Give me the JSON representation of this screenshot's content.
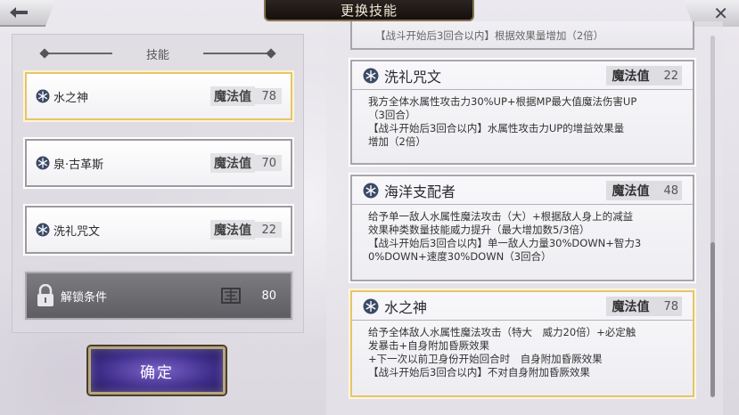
{
  "header": {
    "title": "更换技能"
  },
  "left_panel": {
    "title": "技能",
    "skills": [
      {
        "name": "水之神",
        "mp_label": "魔法值",
        "mp": "78",
        "selected": true
      },
      {
        "name": "泉·古革斯",
        "mp_label": "魔法值",
        "mp": "70",
        "selected": false
      },
      {
        "name": "洗礼咒文",
        "mp_label": "魔法值",
        "mp": "22",
        "selected": false
      }
    ],
    "locked": {
      "label": "解锁条件",
      "value": "80"
    }
  },
  "confirm_label": "确定",
  "list": {
    "partial_top_text": "【战斗开始后3回合以内】根据效果量增加（2倍）",
    "cards": [
      {
        "title": "洗礼咒文",
        "mp_label": "魔法值",
        "mp": "22",
        "lines": [
          "我方全体水属性攻击力30%UP+根据MP最大值魔法伤害UP",
          "（3回合）",
          "【战斗开始后3回合以内】水属性攻击力UP的增益效果量",
          "增加（2倍）"
        ]
      },
      {
        "title": "海洋支配者",
        "mp_label": "魔法值",
        "mp": "48",
        "lines": [
          "给予单一敌人水属性魔法攻击（大）+根据敌人身上的减益",
          "效果种类数量技能威力提升（最大增加数5/3倍）",
          "【战斗开始后3回合以内】单一敌人力量30%DOWN+智力3",
          "0%DOWN+速度30%DOWN（3回合）"
        ]
      },
      {
        "title": "水之神",
        "mp_label": "魔法值",
        "mp": "78",
        "lines": [
          "给予全体敌人水属性魔法攻击（特大　威力20倍）+必定触",
          "发暴击+自身附加昏厥效果",
          "+下一次以前卫身份开始回合时　自身附加昏厥效果",
          "【战斗开始后3回合以内】不对自身附加昏厥效果"
        ]
      }
    ]
  },
  "icons": {
    "skill": "snowflake-icon",
    "back": "back-arrow-icon",
    "close": "close-icon",
    "lock": "lock-icon",
    "stamp": "stamp-icon"
  },
  "colors": {
    "selected_border": "#e6c46a",
    "confirm_bg": "#3f2e8a",
    "header_bg": "#1d1714"
  }
}
